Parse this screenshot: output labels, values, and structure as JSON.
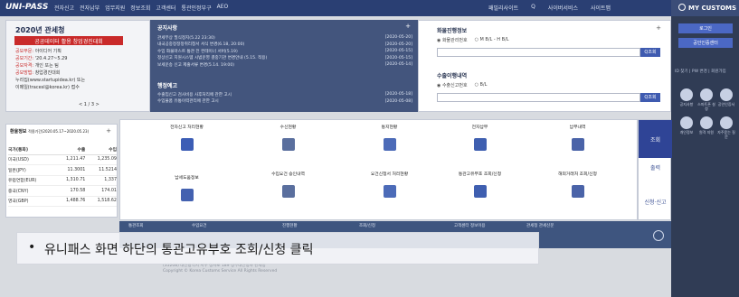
{
  "topbar": {
    "logo": "UNI-PASS",
    "menu": [
      "전자신고",
      "전자납부",
      "업무지원",
      "정보조회",
      "고객센터",
      "통관인정부구",
      "AEO"
    ],
    "right": [
      "패밀리사이트",
      "Q",
      "사이버서비스",
      "사이트맵"
    ],
    "my_customs": "MY CUSTOMS"
  },
  "banner": {
    "year": "2020년 관세청",
    "title": "공공데이터 활용 창업경진대회",
    "rows": [
      {
        "k": "공모부문:",
        "v": "아이디어 기획"
      },
      {
        "k": "공모기간:",
        "v": "'20.4.27~5.29"
      },
      {
        "k": "공모자격:",
        "v": "개인 또는 팀"
      },
      {
        "k": "공모방법:",
        "v": "창업경진대회"
      },
      {
        "k": "",
        "v": "누리집(www.startupidea.kr) 또는"
      },
      {
        "k": "",
        "v": "이메일(tracesl@korea.kr) 접수"
      }
    ],
    "pager": "< 1 / 3 >"
  },
  "notice": {
    "title": "공지사항",
    "plus": "+",
    "items": [
      {
        "t": "관세무상 필식정지(5.22 23:30)",
        "d": "[2020-05-20]"
      },
      {
        "t": "내국공중정정정취리청서 서식 변경(6.18, 20:00)",
        "d": "[2020-05-20]"
      },
      {
        "t": "수입 화물마스트 통관 전 컨테이너 서버(5.19)",
        "d": "[2020-05-15]"
      },
      {
        "t": "정상신고 지원시스템 시범운영 결중기관 변경안내 (5.15. 적용)",
        "d": "[2020-05-15]"
      },
      {
        "t": "보세운송 신고 제출서류 변경(5.14. 19:00)",
        "d": "[2020-05-14]"
      }
    ],
    "title2": "행정예고",
    "items2": [
      {
        "t": "수출입신고 검사비용 사후처리에 관한 고시",
        "d": "[2020-05-18]"
      },
      {
        "t": "수입물품 유통이력관리에 관한 고시",
        "d": "[2020-05-08]"
      }
    ]
  },
  "cargo": {
    "title1": "화물진행정보",
    "radios1": [
      "화물관리번호",
      "M B/L - H B/L"
    ],
    "btn1": "Q조회",
    "plus": "+",
    "title2": "수출이행내역",
    "radios2": [
      "수출신고번호",
      "B/L"
    ],
    "btn2": "Q조회"
  },
  "rightside": {
    "login": "로그인",
    "cert": "공인인증센터",
    "small": "ID 찾기 | PW 변경 | 회원가입",
    "icons": [
      {
        "label": "공지사항",
        "icon": "megaphone-icon"
      },
      {
        "label": "스마트폰 설정",
        "icon": "phone-icon"
      },
      {
        "label": "공인인증서",
        "icon": "cert-icon"
      },
      {
        "label": "개인정보",
        "icon": "chat-icon"
      },
      {
        "label": "원격 지원",
        "icon": "user-icon"
      },
      {
        "label": "자주묻는 질문",
        "icon": "help-icon"
      }
    ]
  },
  "rates": {
    "title": "환율정보",
    "sub": "적용기간(2020.05.17~2020.05.23)",
    "plus": "+",
    "headers": [
      "국가(통화)",
      "수출",
      "수입"
    ],
    "rows": [
      [
        "미국(USD)",
        "1,211.47",
        "1,235.09"
      ],
      [
        "일본(JPY)",
        "11.3001",
        "11.5214"
      ],
      [
        "유럽연합(EUR)",
        "1,310.71",
        "1,337"
      ],
      [
        "중국(CNY)",
        "170.58",
        "174.01"
      ],
      [
        "영국(GBP)",
        "1,488.76",
        "1,518.62"
      ]
    ]
  },
  "grid": {
    "top": [
      "전자신고 처리현황",
      "수신현황",
      "통지현황",
      "전자납부",
      "납부내역"
    ],
    "bottom": [
      "납세도움정보",
      "수입요건 승인내역",
      "요건신청서 처리현황",
      "통관고유부호 조회/신청",
      "해외거래처 조회/신청"
    ]
  },
  "side_tabs": [
    "조회",
    "출력",
    "신청·신고"
  ],
  "qbar": [
    "통관조회",
    "수입요건",
    "진행현황",
    "조회/신청",
    "고객센터 정보이용",
    "관세청 관세신문"
  ],
  "footer": [
    "(35208) 대전광역시 서구 청사로 189 정부대전청사 관세청",
    "Copyright © Korea Customs Service All Rights Reserved"
  ],
  "caption": {
    "bullet": "•",
    "text": "유니패스 화면 하단의 통관고유부호 조회/신청 클릭"
  },
  "colors": {
    "navy": "#2a3f73",
    "panel": "#43557d",
    "accent_blue": "#4b68c4",
    "red": "#c92a2a"
  }
}
